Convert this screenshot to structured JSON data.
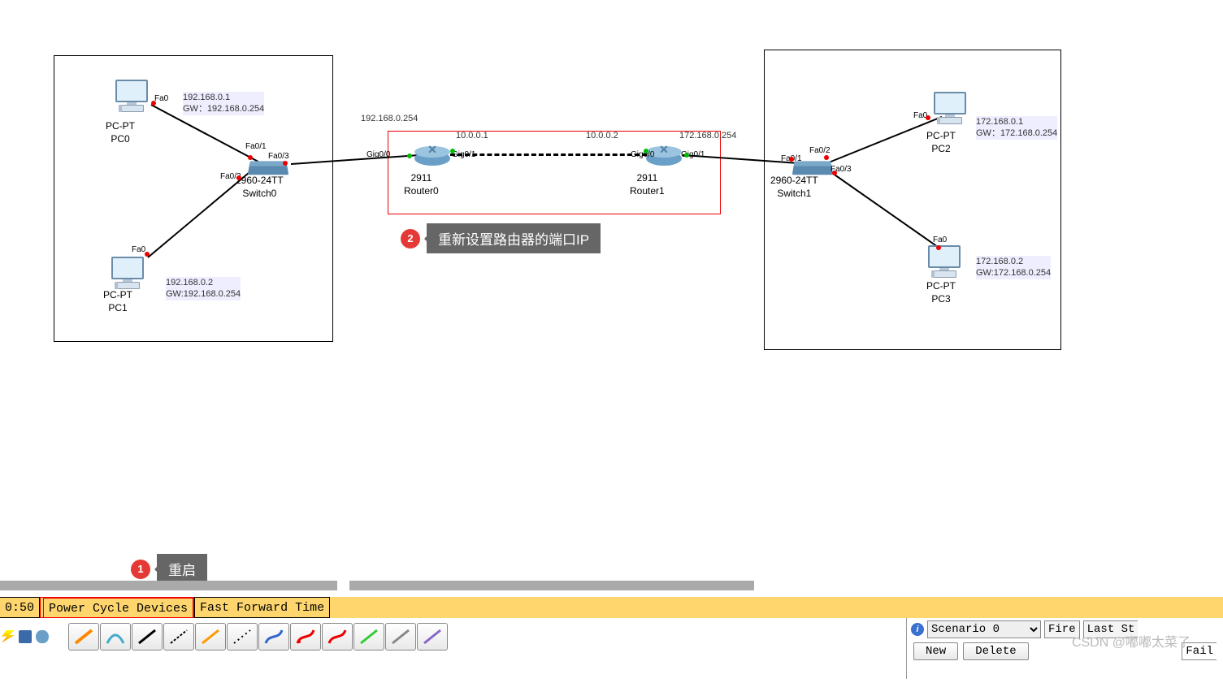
{
  "subnet_left": {
    "pc0": {
      "name": "PC-PT\nPC0",
      "ip": "192.168.0.1\nGW：192.168.0.254",
      "port": "Fa0"
    },
    "pc1": {
      "name": "PC-PT\nPC1",
      "ip": "192.168.0.2\nGW:192.168.0.254",
      "port": "Fa0"
    },
    "switch": {
      "name": "2960-24TT\nSwitch0",
      "p1": "Fa0/1",
      "p2": "Fa0/2",
      "p3": "Fa0/3"
    }
  },
  "subnet_right": {
    "pc2": {
      "name": "PC-PT\nPC2",
      "ip": "172.168.0.1\nGW：172.168.0.254",
      "port": "Fa0"
    },
    "pc3": {
      "name": "PC-PT\nPC3",
      "ip": "172.168.0.2\nGW:172.168.0.254",
      "port": "Fa0"
    },
    "switch": {
      "name": "2960-24TT\nSwitch1",
      "p1": "Fa0/1",
      "p2": "Fa0/2",
      "p3": "Fa0/3"
    }
  },
  "routers": {
    "r0": {
      "name": "2911\nRouter0",
      "p_left": "Gig0/0",
      "p_right": "Gig0/1"
    },
    "r1": {
      "name": "2911\nRouter1",
      "p_left": "Gig0/0",
      "p_right": "Gig0/1"
    },
    "link_left_ip": "192.168.0.254",
    "link_r0_ip": "10.0.0.1",
    "link_r1_ip": "10.0.0.2",
    "link_right_ip": "172.168.0.254"
  },
  "ann1": {
    "num": "1",
    "text": "重启"
  },
  "ann2": {
    "num": "2",
    "text": "重新设置路由器的端口IP"
  },
  "status": {
    "time": "0:50",
    "power": "Power Cycle Devices",
    "fast": "Fast Forward Time"
  },
  "panel": {
    "scenario": "Scenario 0",
    "fire": "Fire",
    "last": "Last St",
    "new": "New",
    "delete": "Delete",
    "fail": "Fail"
  },
  "watermark": "CSDN @嘟嘟太菜了"
}
